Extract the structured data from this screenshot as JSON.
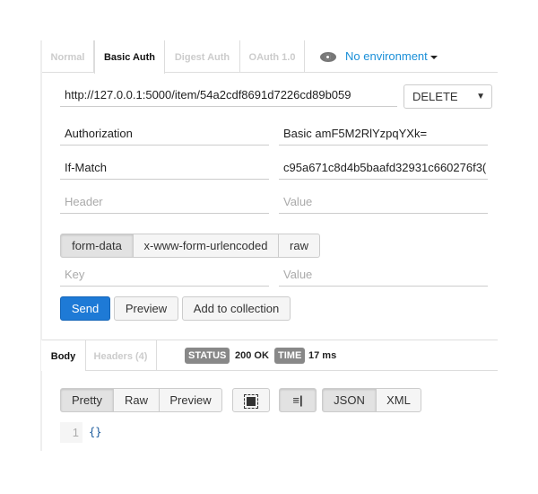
{
  "auth_tabs": [
    {
      "label": "Normal"
    },
    {
      "label": "Basic Auth",
      "active": true
    },
    {
      "label": "Digest Auth"
    },
    {
      "label": "OAuth 1.0"
    }
  ],
  "environment": {
    "label": "No environment",
    "icon": "eye-icon"
  },
  "request": {
    "url": "http://127.0.0.1:5000/item/54a2cdf8691d7226cd89b059",
    "method": "DELETE"
  },
  "headers": [
    {
      "key": "Authorization",
      "value": "Basic amF5M2RlYzpqYXk="
    },
    {
      "key": "If-Match",
      "value": "c95a671c8d4b5baafd32931c660276f3("
    }
  ],
  "header_placeholder": {
    "key": "Header",
    "value": "Value"
  },
  "body_modes": [
    {
      "label": "form-data",
      "active": true
    },
    {
      "label": "x-www-form-urlencoded"
    },
    {
      "label": "raw"
    }
  ],
  "form_placeholder": {
    "key": "Key",
    "value": "Value"
  },
  "actions": {
    "send": "Send",
    "preview": "Preview",
    "add": "Add to collection"
  },
  "response": {
    "tabs": [
      {
        "label": "Body",
        "active": true
      },
      {
        "label": "Headers (4)"
      }
    ],
    "status_label": "STATUS",
    "status": "200 OK",
    "time_label": "TIME",
    "time": "17 ms",
    "views": [
      {
        "label": "Pretty",
        "active": true
      },
      {
        "label": "Raw"
      },
      {
        "label": "Preview"
      }
    ],
    "formats": [
      {
        "label": "JSON",
        "active": true
      },
      {
        "label": "XML"
      }
    ],
    "line_number": "1",
    "body": "{}"
  },
  "colors": {
    "accent": "#1a8fd8",
    "send": "#1e7ad6"
  }
}
